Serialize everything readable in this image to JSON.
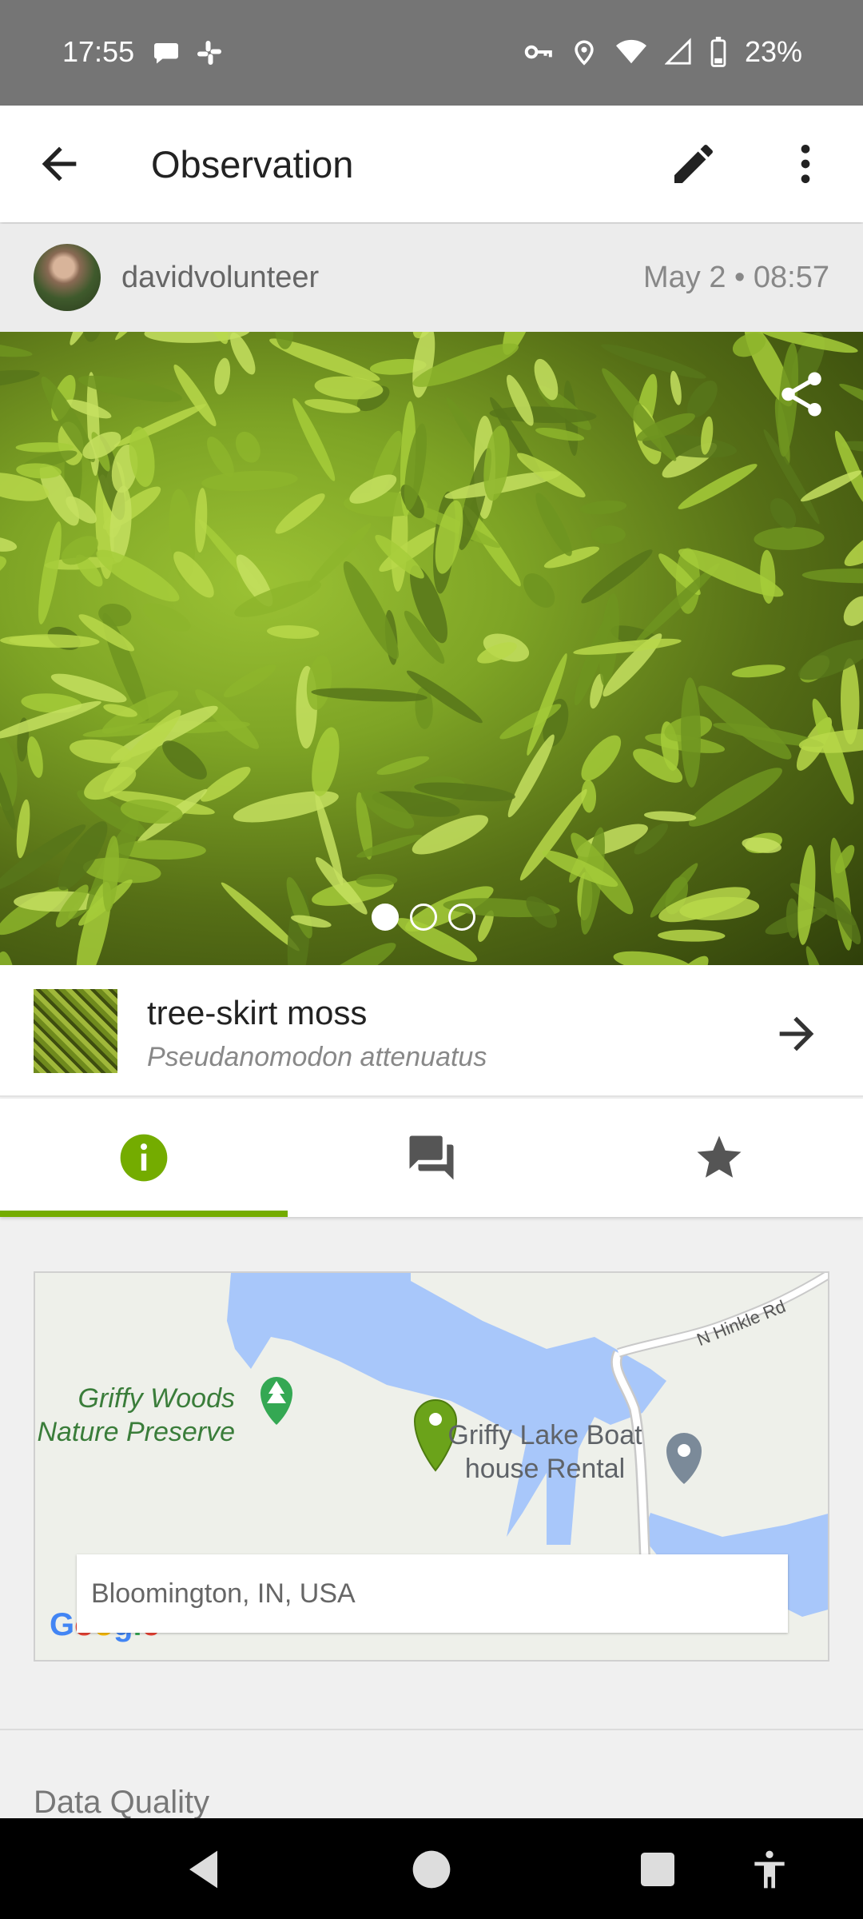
{
  "status": {
    "time": "17:55",
    "battery": "23%",
    "icons": [
      "chat-bubble-icon",
      "slack-icon",
      "vpn-key-icon",
      "location-icon",
      "wifi-icon",
      "signal-icon",
      "battery-icon"
    ]
  },
  "app_bar": {
    "title": "Observation",
    "icons": [
      "arrow-back-icon",
      "edit-pencil-icon",
      "more-vert-icon"
    ]
  },
  "observation": {
    "username": "davidvolunteer",
    "date": "May 2 • 08:57",
    "photo_count": 3,
    "photo_index": 1
  },
  "species": {
    "common_name": "tree-skirt moss",
    "scientific_name": "Pseudanomodon attenuatus"
  },
  "tabs": [
    {
      "icon": "info-icon",
      "active": true
    },
    {
      "icon": "forum-icon",
      "active": false
    },
    {
      "icon": "star-icon",
      "active": false
    }
  ],
  "map": {
    "labels": {
      "preserve": "Griffy Woods\nNature Preserve",
      "boathouse": "Griffy Lake Boat\nhouse Rental",
      "road": "N Hinkle Rd"
    },
    "location": "Bloomington, IN, USA",
    "attribution": "Google"
  },
  "sections": {
    "data_quality": "Data Quality"
  },
  "colors": {
    "accent": "#74ac00",
    "water": "#a8c7fa",
    "status_bar": "#757575"
  }
}
